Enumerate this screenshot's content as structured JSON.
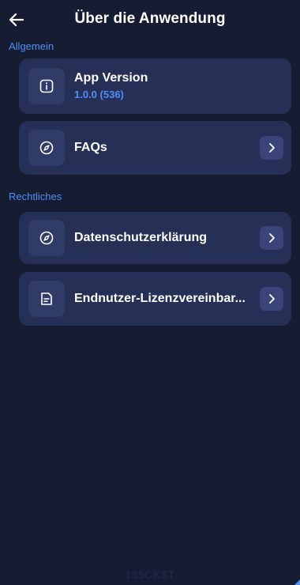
{
  "header": {
    "title": "Über die Anwendung",
    "back_icon": "arrow-left-icon"
  },
  "sections": {
    "general": {
      "label": "Allgemein",
      "app_version": {
        "label": "App Version",
        "value": "1.0.0 (536)",
        "icon": "info-icon"
      },
      "faqs": {
        "label": "FAQs",
        "icon": "compass-icon"
      }
    },
    "legal": {
      "label": "Rechtliches",
      "privacy": {
        "label": "Datenschutzerklärung",
        "icon": "compass-icon"
      },
      "eula": {
        "label": "Endnutzer-Lizenzvereinbar...",
        "icon": "document-icon"
      }
    }
  },
  "footer": {
    "watermark": "135CK8T"
  },
  "colors": {
    "background": "#161d33",
    "card": "#262f55",
    "icon_box": "#313b67",
    "chevron_box": "#3a4478",
    "accent": "#4f8ef7"
  }
}
